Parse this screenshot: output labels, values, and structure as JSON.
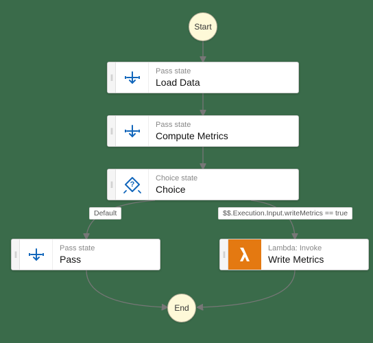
{
  "terminals": {
    "start": "Start",
    "end": "End"
  },
  "nodes": {
    "loadData": {
      "type": "Pass state",
      "name": "Load Data"
    },
    "computeMetrics": {
      "type": "Pass state",
      "name": "Compute Metrics"
    },
    "choice": {
      "type": "Choice state",
      "name": "Choice"
    },
    "pass": {
      "type": "Pass state",
      "name": "Pass"
    },
    "writeMetrics": {
      "type": "Lambda: Invoke",
      "name": "Write Metrics"
    }
  },
  "edgeLabels": {
    "default": "Default",
    "condition": "$$.Execution.Input.writeMetrics == true"
  },
  "icons": {
    "pass": "pass-icon",
    "choice": "choice-icon",
    "lambda": "lambda-icon"
  },
  "colors": {
    "passStroke": "#1166bb",
    "lambdaBg": "#e47911"
  }
}
